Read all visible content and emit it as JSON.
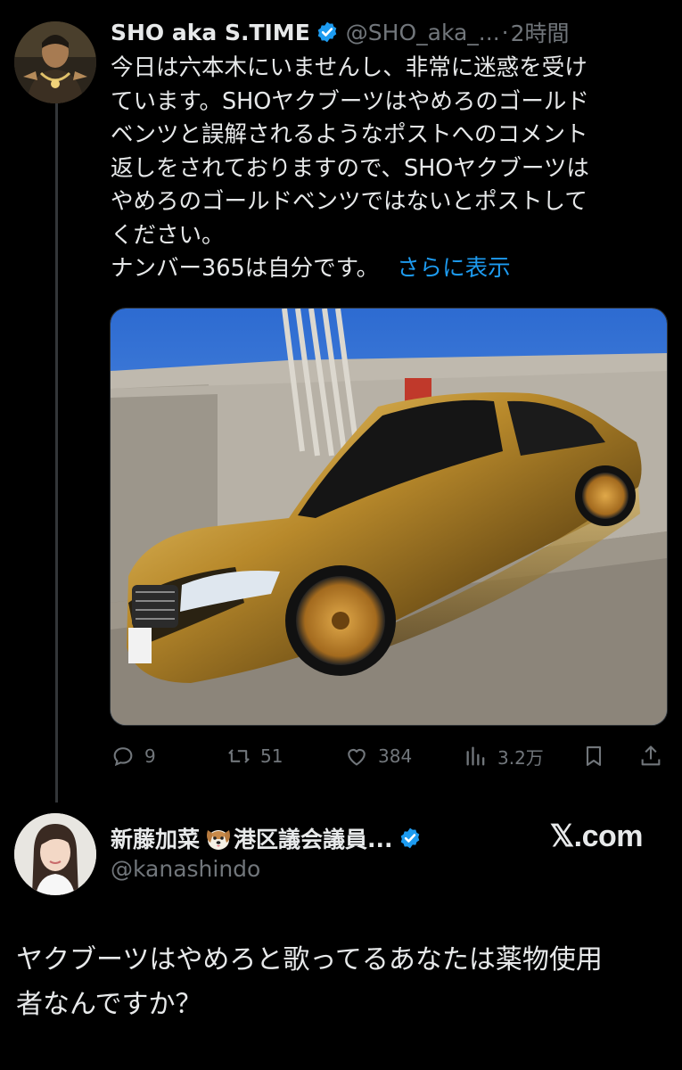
{
  "tweet": {
    "display_name": "SHO aka S.TIME",
    "handle": "@SHO_aka_...",
    "separator": "·",
    "time": "2時間",
    "lines": [
      "今日は六本木にいませんし、非常に迷惑を受け",
      "ています。SHOヤクブーツはやめろのゴールド",
      "ベンツと誤解されるようなポストへのコメント",
      "返しをされておりますので、SHOヤクブーツは",
      "やめろのゴールドベンツではないとポストして",
      "ください。"
    ],
    "last_line": "ナンバー365は自分です。",
    "show_more": "さらに表示",
    "actions": {
      "reply_count": "9",
      "repost_count": "51",
      "like_count": "384",
      "views_count": "3.2万"
    }
  },
  "quoted_user": {
    "display_name": "新藤加菜",
    "name_suffix": "港区議会議員...",
    "handle": "@kanashindo",
    "watermark": "𝕏.com"
  },
  "reply": {
    "lines": [
      "ヤクブーツはやめろと歌ってるあなたは薬物使用",
      "者なんですか？"
    ]
  },
  "icons": [
    "verified-badge-icon",
    "reply-icon",
    "repost-icon",
    "like-icon",
    "views-icon",
    "bookmark-icon",
    "share-icon",
    "dog-emoji-icon"
  ],
  "colors": {
    "background": "#000000",
    "text": "#e7e9ea",
    "muted": "#71767b",
    "link": "#1d9bf0",
    "verified": "#1d9bf0"
  }
}
